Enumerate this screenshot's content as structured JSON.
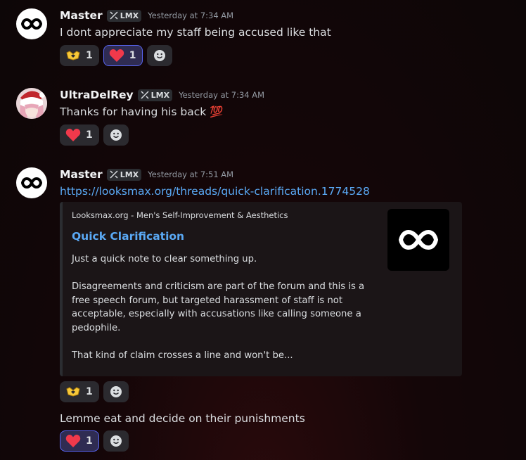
{
  "messages": [
    {
      "author": "Master",
      "tag": "LMX",
      "timestamp": "Yesterday at 7:34 AM",
      "text": "I dont appreciate my staff being accused like that",
      "reactions": [
        {
          "emoji": "handheart-icon",
          "count": "1",
          "me": false
        },
        {
          "emoji": "heart-icon",
          "count": "1",
          "me": true
        }
      ]
    },
    {
      "author": "UltraDelRey",
      "tag": "LMX",
      "timestamp": "Yesterday at 7:34 AM",
      "text": "Thanks for having his back",
      "text_emoji": "💯",
      "reactions": [
        {
          "emoji": "heart-icon",
          "count": "1",
          "me": false
        }
      ]
    },
    {
      "author": "Master",
      "tag": "LMX",
      "timestamp": "Yesterday at 7:51 AM",
      "link": "https://looksmax.org/threads/quick-clarification.1774528",
      "embed": {
        "provider": "Looksmax.org - Men's Self-Improvement & Aesthetics",
        "title": "Quick Clarification",
        "description": "Just a quick note to clear something up.\n\nDisagreements and criticism are part of the forum and this is a free speech forum, but targeted harassment of staff is not acceptable, especially with accusations like calling someone a pedophile.\n\nThat kind of claim crosses a line and won't be..."
      },
      "reactions": [
        {
          "emoji": "handheart-icon",
          "count": "1",
          "me": false
        }
      ]
    },
    {
      "text": "Lemme eat and decide on their punishments",
      "reactions": [
        {
          "emoji": "heart-icon",
          "count": "1",
          "me": true
        }
      ]
    }
  ],
  "colors": {
    "link": "#5aa9f5",
    "reaction_me_border": "#5865f2",
    "heart": "#f0394b",
    "handheart": "#f6c83a"
  }
}
